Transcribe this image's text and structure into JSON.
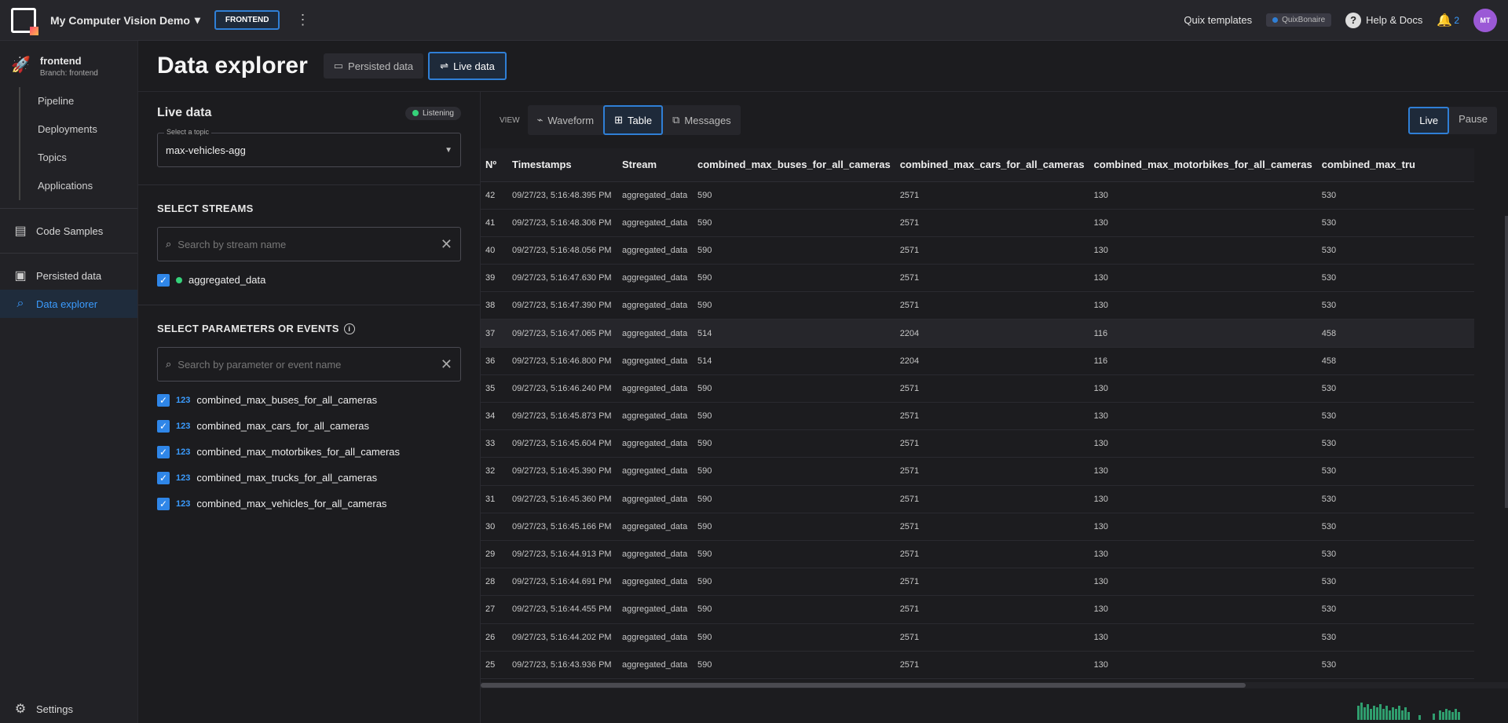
{
  "topbar": {
    "project_name": "My Computer Vision Demo",
    "environment": "FRONTEND",
    "quix_templates": "Quix templates",
    "quix_badge": "QuixBonaire",
    "help": "Help & Docs",
    "notifications": "2",
    "avatar_initials": "MT"
  },
  "sidebar": {
    "project": "frontend",
    "branch": "Branch: frontend",
    "sub_items": [
      "Pipeline",
      "Deployments",
      "Topics",
      "Applications"
    ],
    "code_samples": "Code Samples",
    "persisted_data": "Persisted data",
    "data_explorer": "Data explorer",
    "settings": "Settings"
  },
  "header": {
    "title": "Data explorer",
    "tab_persisted": "Persisted data",
    "tab_live": "Live data"
  },
  "left": {
    "title": "Live data",
    "status": "Listening",
    "topic_label": "Select a topic",
    "topic_value": "max-vehicles-agg",
    "streams_title": "SELECT STREAMS",
    "stream_search_placeholder": "Search by stream name",
    "streams": [
      "aggregated_data"
    ],
    "params_title": "SELECT PARAMETERS OR EVENTS",
    "param_search_placeholder": "Search by parameter or event name",
    "param_type": "123",
    "params": [
      "combined_max_buses_for_all_cameras",
      "combined_max_cars_for_all_cameras",
      "combined_max_motorbikes_for_all_cameras",
      "combined_max_trucks_for_all_cameras",
      "combined_max_vehicles_for_all_cameras"
    ]
  },
  "right": {
    "view_label": "VIEW",
    "view_waveform": "Waveform",
    "view_table": "Table",
    "view_messages": "Messages",
    "live": "Live",
    "pause": "Pause"
  },
  "table": {
    "columns": [
      "Nº",
      "Timestamps",
      "Stream",
      "combined_max_buses_for_all_cameras",
      "combined_max_cars_for_all_cameras",
      "combined_max_motorbikes_for_all_cameras",
      "combined_max_tru"
    ],
    "rows": [
      [
        "42",
        "09/27/23, 5:16:48.395 PM",
        "aggregated_data",
        "590",
        "2571",
        "130",
        "530"
      ],
      [
        "41",
        "09/27/23, 5:16:48.306 PM",
        "aggregated_data",
        "590",
        "2571",
        "130",
        "530"
      ],
      [
        "40",
        "09/27/23, 5:16:48.056 PM",
        "aggregated_data",
        "590",
        "2571",
        "130",
        "530"
      ],
      [
        "39",
        "09/27/23, 5:16:47.630 PM",
        "aggregated_data",
        "590",
        "2571",
        "130",
        "530"
      ],
      [
        "38",
        "09/27/23, 5:16:47.390 PM",
        "aggregated_data",
        "590",
        "2571",
        "130",
        "530"
      ],
      [
        "37",
        "09/27/23, 5:16:47.065 PM",
        "aggregated_data",
        "514",
        "2204",
        "116",
        "458"
      ],
      [
        "36",
        "09/27/23, 5:16:46.800 PM",
        "aggregated_data",
        "514",
        "2204",
        "116",
        "458"
      ],
      [
        "35",
        "09/27/23, 5:16:46.240 PM",
        "aggregated_data",
        "590",
        "2571",
        "130",
        "530"
      ],
      [
        "34",
        "09/27/23, 5:16:45.873 PM",
        "aggregated_data",
        "590",
        "2571",
        "130",
        "530"
      ],
      [
        "33",
        "09/27/23, 5:16:45.604 PM",
        "aggregated_data",
        "590",
        "2571",
        "130",
        "530"
      ],
      [
        "32",
        "09/27/23, 5:16:45.390 PM",
        "aggregated_data",
        "590",
        "2571",
        "130",
        "530"
      ],
      [
        "31",
        "09/27/23, 5:16:45.360 PM",
        "aggregated_data",
        "590",
        "2571",
        "130",
        "530"
      ],
      [
        "30",
        "09/27/23, 5:16:45.166 PM",
        "aggregated_data",
        "590",
        "2571",
        "130",
        "530"
      ],
      [
        "29",
        "09/27/23, 5:16:44.913 PM",
        "aggregated_data",
        "590",
        "2571",
        "130",
        "530"
      ],
      [
        "28",
        "09/27/23, 5:16:44.691 PM",
        "aggregated_data",
        "590",
        "2571",
        "130",
        "530"
      ],
      [
        "27",
        "09/27/23, 5:16:44.455 PM",
        "aggregated_data",
        "590",
        "2571",
        "130",
        "530"
      ],
      [
        "26",
        "09/27/23, 5:16:44.202 PM",
        "aggregated_data",
        "590",
        "2571",
        "130",
        "530"
      ],
      [
        "25",
        "09/27/23, 5:16:43.936 PM",
        "aggregated_data",
        "590",
        "2571",
        "130",
        "530"
      ]
    ],
    "highlight_row": 5
  },
  "colors": {
    "accent": "#2f7fd6",
    "status_green": "#35d27a",
    "background": "#1c1c1f"
  }
}
